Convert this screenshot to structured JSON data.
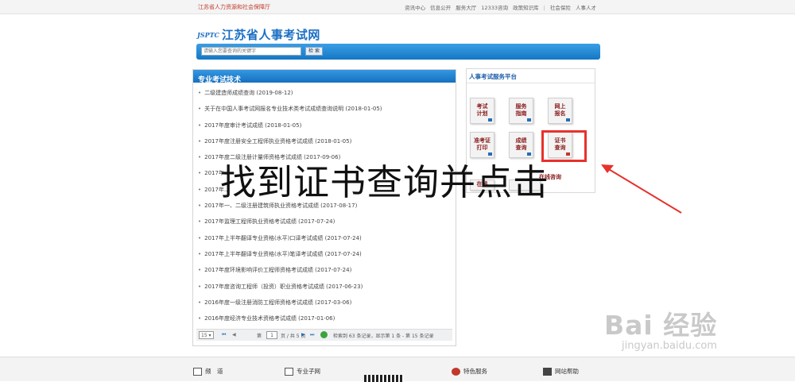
{
  "topbar": {
    "org": "江苏省人力资源和社会保障厅",
    "links": [
      "资讯中心",
      "信息公开",
      "服务大厅",
      "12333咨询",
      "政策知识库",
      "|",
      "社会保险",
      "人事人才"
    ]
  },
  "logo": {
    "mark": "JSPTC",
    "title": "江苏省人事考试网"
  },
  "search": {
    "placeholder": "请输入您要查询的关键字",
    "button": "检 索"
  },
  "left": {
    "title": "专业考试技术",
    "items": [
      "二级建造师成绩查询 (2019-08-12)",
      "关于在中国人事考试网报名专业技术类考试成绩查询说明 (2018-01-05)",
      "2017年度审计考试成绩 (2018-01-05)",
      "2017年度注册安全工程师执业资格考试成绩 (2018-01-05)",
      "2017年度二级注册计量师资格考试成绩 (2017-09-06)",
      "2017年...",
      "2017年...",
      "2017年一、二级注册建筑师执业资格考试成绩 (2017-08-17)",
      "2017年监理工程师执业资格考试成绩 (2017-07-24)",
      "2017年上半年翻译专业资格(水平)口译考试成绩 (2017-07-24)",
      "2017年上半年翻译专业资格(水平)笔译考试成绩 (2017-07-24)",
      "2017年度环境影响评价工程师资格考试成绩 (2017-07-24)",
      "2017年度咨询工程师（投资）职业资格考试成绩 (2017-06-23)",
      "2016年度一级注册消防工程师资格考试成绩 (2017-03-06)",
      "2016年度经济专业技术资格考试成绩 (2017-01-06)"
    ],
    "pager": {
      "page_size": "15 ▾",
      "first": "⏮",
      "prev": "◀",
      "page_label": "第",
      "page_value": "1",
      "page_total": "页 / 共 5 页",
      "next": "▶",
      "last": "⏭",
      "summary": "检索到 63 条记录，显示第 1 条 - 第 15 条记录"
    }
  },
  "right": {
    "title": "人事考试服务平台",
    "tiles": [
      {
        "l1": "考试",
        "l2": "计划"
      },
      {
        "l1": "服务",
        "l2": "指南"
      },
      {
        "l1": "网上",
        "l2": "报名"
      },
      {
        "l1": "准考证",
        "l2": "打印"
      },
      {
        "l1": "成绩",
        "l2": "查询"
      },
      {
        "l1": "证书",
        "l2": "查询"
      },
      {
        "l1": "在线",
        "l2": ""
      },
      {
        "l1": "",
        "l2": ""
      },
      {
        "l1": "在线咨询",
        "l2": ""
      }
    ]
  },
  "overlay": {
    "text": "找到证书查询并点击"
  },
  "footer": {
    "items": [
      "频　道",
      "专业子网",
      "特色服务",
      "网站帮助"
    ]
  },
  "watermark": {
    "brand": "Bai 经验",
    "url": "jingyan.baidu.com"
  },
  "colors": {
    "accent": "#1a6fc4",
    "highlight": "#e8312b",
    "tile_text": "#8b1a1a"
  }
}
